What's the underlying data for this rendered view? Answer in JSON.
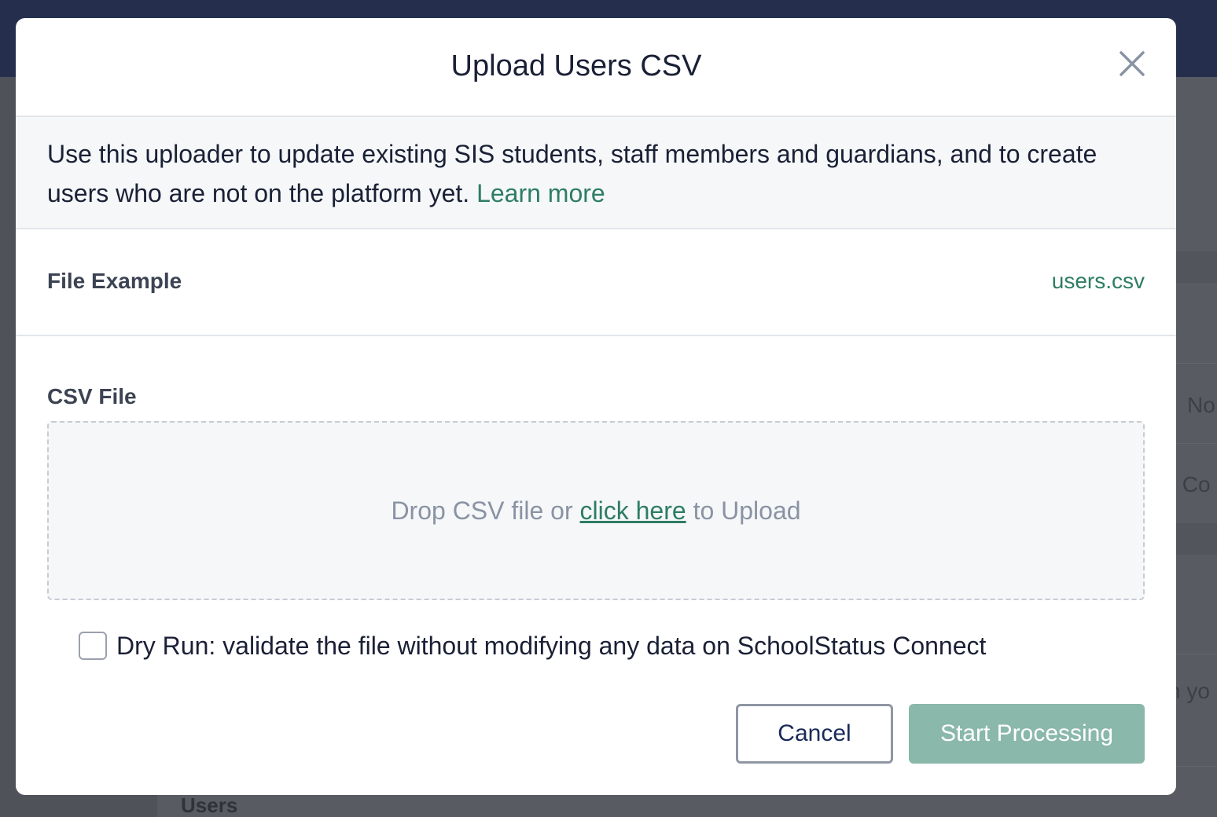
{
  "modal": {
    "title": "Upload Users CSV",
    "close_icon": "close-icon",
    "info": {
      "text": "Use this uploader to update existing SIS students, staff members and guardians, and to create users who are not on the platform yet.",
      "learn_more": "Learn more"
    },
    "file_example": {
      "label": "File Example",
      "file_name": "users.csv"
    },
    "csv_file": {
      "label": "CSV File",
      "dropzone": {
        "prefix": "Drop CSV file or",
        "link": "click here",
        "suffix": "to Upload"
      }
    },
    "dry_run": {
      "checked": false,
      "label": "Dry Run: validate the file without modifying any data on SchoolStatus Connect"
    },
    "buttons": {
      "cancel": "Cancel",
      "start": "Start Processing"
    }
  },
  "background": {
    "fragments": [
      "No",
      "s Co",
      "n yo"
    ],
    "section_title": "Users"
  },
  "colors": {
    "accent": "#2e7d63",
    "start_button_disabled": "#8ab8aa",
    "topbar": "#252f4d"
  }
}
